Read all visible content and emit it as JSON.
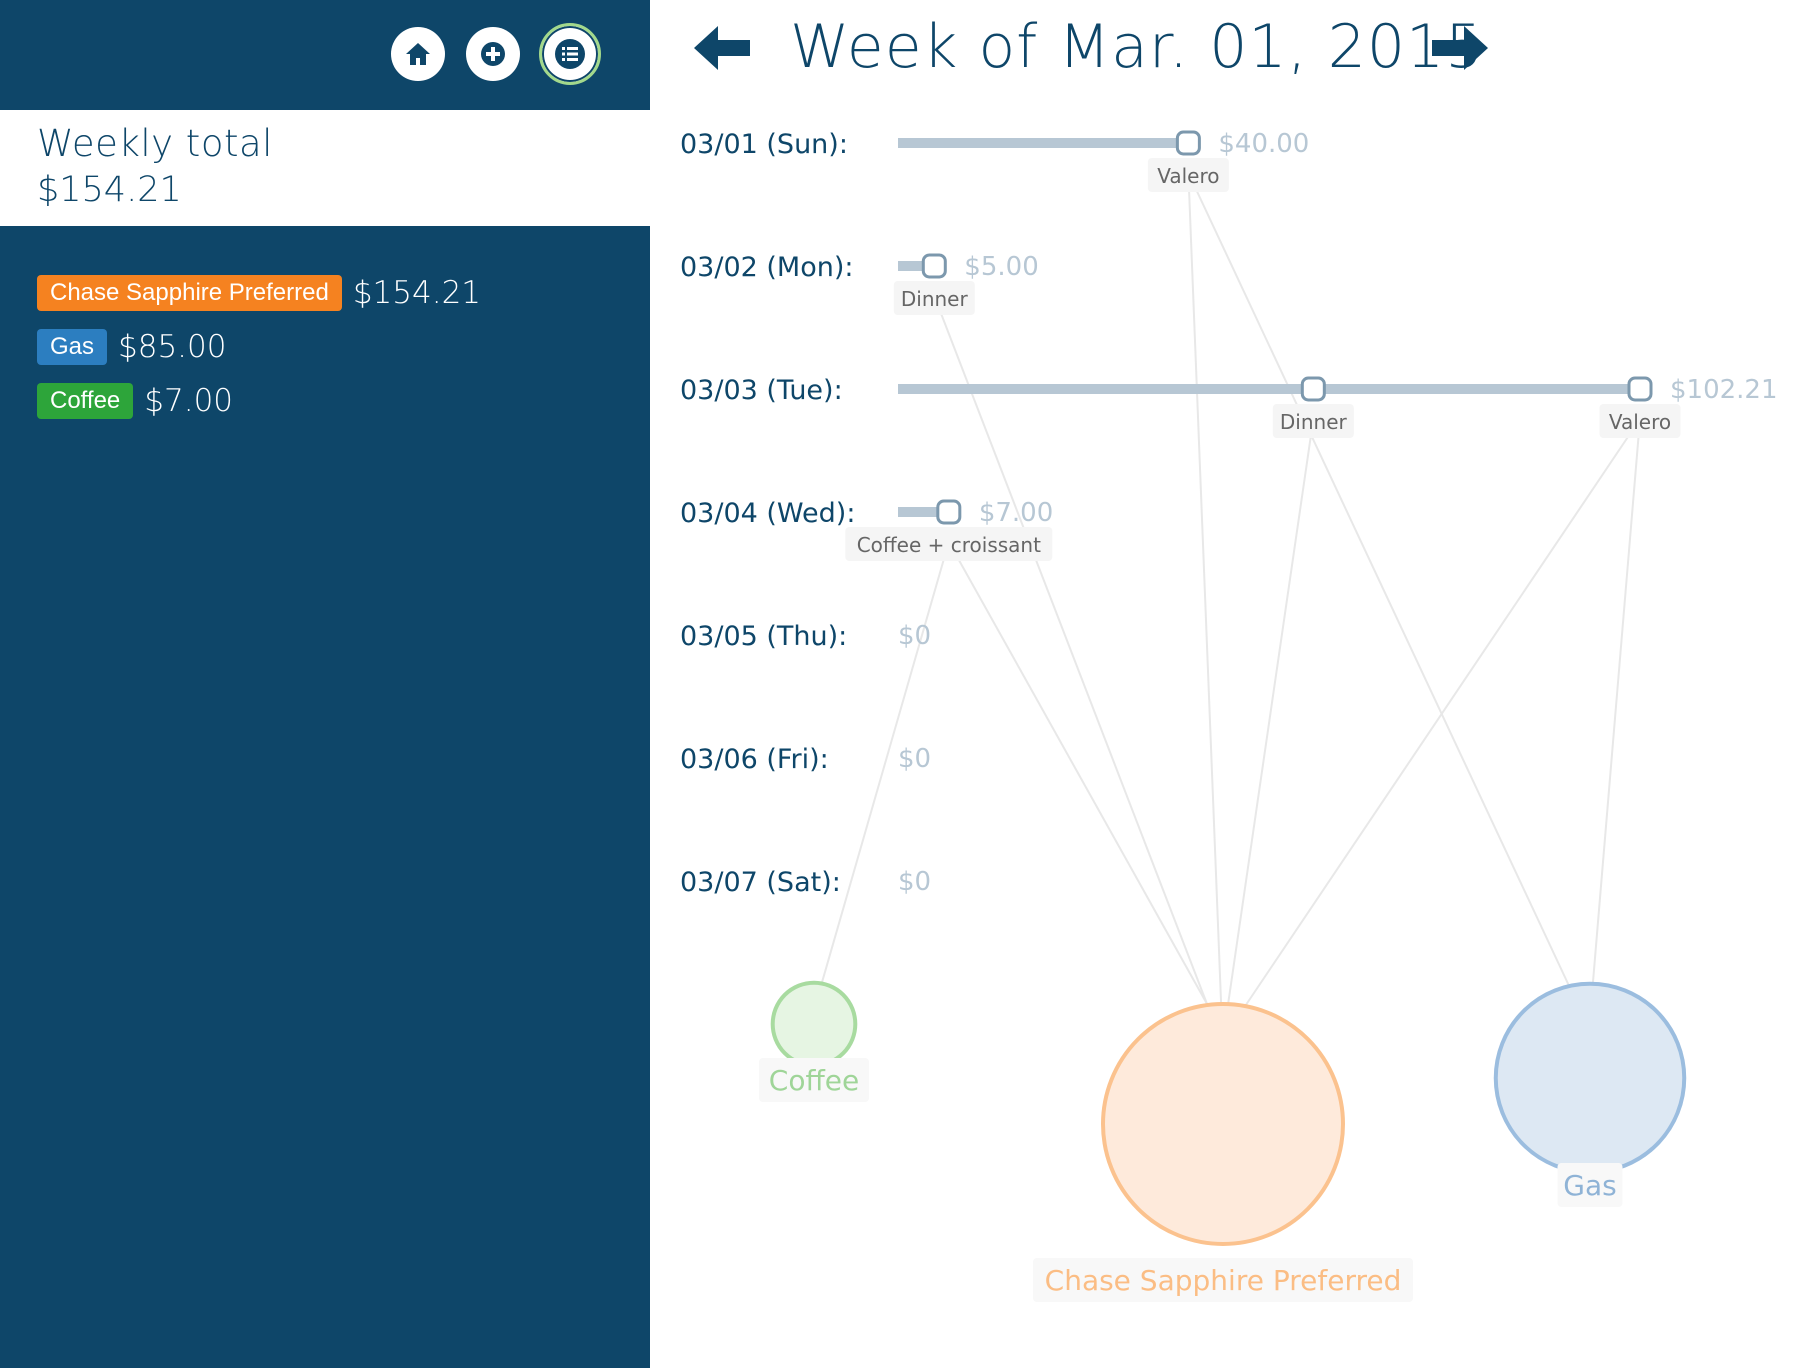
{
  "header": {
    "title": "Week of Mar. 01, 2015",
    "nav_buttons": [
      {
        "name": "home",
        "icon": "home-icon"
      },
      {
        "name": "add",
        "icon": "plus-circle-icon"
      },
      {
        "name": "list",
        "icon": "list-icon",
        "active": true
      }
    ]
  },
  "summary": {
    "label": "Weekly total",
    "total": "$154.21"
  },
  "categories": [
    {
      "name": "Chase Sapphire Preferred",
      "amount": "$154.21",
      "color": "#f58220"
    },
    {
      "name": "Gas",
      "amount": "$85.00",
      "color": "#2c7ec0"
    },
    {
      "name": "Coffee",
      "amount": "$7.00",
      "color": "#2da53a"
    }
  ],
  "days": [
    {
      "label": "03/01 (Sun):",
      "total": 40.0,
      "total_label": "$40.00",
      "items": [
        {
          "name": "Valero",
          "cumulative": 40.0
        }
      ]
    },
    {
      "label": "03/02 (Mon):",
      "total": 5.0,
      "total_label": "$5.00",
      "items": [
        {
          "name": "Dinner",
          "cumulative": 5.0
        }
      ]
    },
    {
      "label": "03/03 (Tue):",
      "total": 102.21,
      "total_label": "$102.21",
      "items": [
        {
          "name": "Dinner",
          "cumulative": 57.21
        },
        {
          "name": "Valero",
          "cumulative": 102.21
        }
      ]
    },
    {
      "label": "03/04 (Wed):",
      "total": 7.0,
      "total_label": "$7.00",
      "items": [
        {
          "name": "Coffee + croissant",
          "cumulative": 7.0
        }
      ]
    },
    {
      "label": "03/05 (Thu):",
      "total": 0,
      "total_label": "$0",
      "items": []
    },
    {
      "label": "03/06 (Fri):",
      "total": 0,
      "total_label": "$0",
      "items": []
    },
    {
      "label": "03/07 (Sat):",
      "total": 0,
      "total_label": "$0",
      "items": []
    }
  ],
  "scale_max": 102.21,
  "category_nodes": [
    {
      "name": "Coffee",
      "total": 7.0,
      "fill": "#e6f5e3",
      "stroke": "#a8dba0",
      "text": "#9fd598"
    },
    {
      "name": "Chase Sapphire Preferred",
      "total": 154.21,
      "fill": "#feeadb",
      "stroke": "#fbc28e",
      "text": "#fbbd84"
    },
    {
      "name": "Gas",
      "total": 85.0,
      "fill": "#dde8f3",
      "stroke": "#9bbddf",
      "text": "#8fb3d6"
    }
  ],
  "links": [
    {
      "day": 0,
      "item": 0,
      "node": 1
    },
    {
      "day": 0,
      "item": 0,
      "node": 2
    },
    {
      "day": 1,
      "item": 0,
      "node": 1
    },
    {
      "day": 2,
      "item": 0,
      "node": 1
    },
    {
      "day": 2,
      "item": 1,
      "node": 1
    },
    {
      "day": 2,
      "item": 1,
      "node": 2
    },
    {
      "day": 3,
      "item": 0,
      "node": 0
    },
    {
      "day": 3,
      "item": 0,
      "node": 1
    }
  ]
}
